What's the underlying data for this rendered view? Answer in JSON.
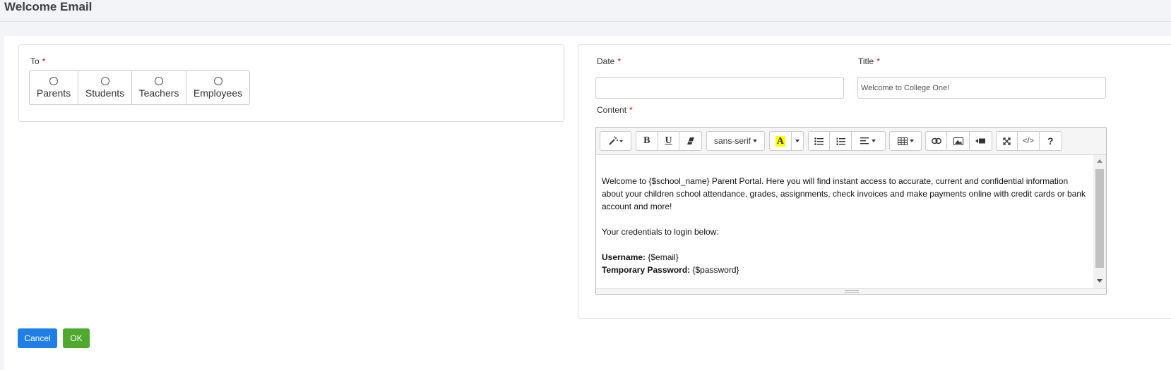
{
  "page": {
    "title": "Welcome Email"
  },
  "to": {
    "label": "To",
    "required_mark": "*",
    "options": [
      "Parents",
      "Students",
      "Teachers",
      "Employees"
    ]
  },
  "date": {
    "label": "Date",
    "required_mark": "*",
    "value": ""
  },
  "title_field": {
    "label": "Title",
    "required_mark": "*",
    "value": "Welcome to College One!"
  },
  "content": {
    "label": "Content",
    "required_mark": "*",
    "toolbar": {
      "font_name": "sans-serif",
      "highlight_glyph": "A",
      "bold_glyph": "B",
      "underline_glyph": "U",
      "codeview_glyph": "</>",
      "help_glyph": "?"
    },
    "body": {
      "paragraph1": "Welcome to {$school_name} Parent Portal. Here you will find instant access to accurate, current and confidential information about your children school attendance, grades, assignments, check invoices and make payments online with credit cards or bank account and more!",
      "paragraph2": "Your credentials to login below:",
      "username_label": "Username:",
      "username_value": " {$email}",
      "password_label": "Temporary Password:",
      "password_value": " {$password}"
    }
  },
  "actions": {
    "cancel": "Cancel",
    "ok": "OK"
  },
  "colors": {
    "cancel": "#1f7fe6",
    "ok": "#4fa92e",
    "required": "#d0021b",
    "highlight": "#ffff00"
  }
}
